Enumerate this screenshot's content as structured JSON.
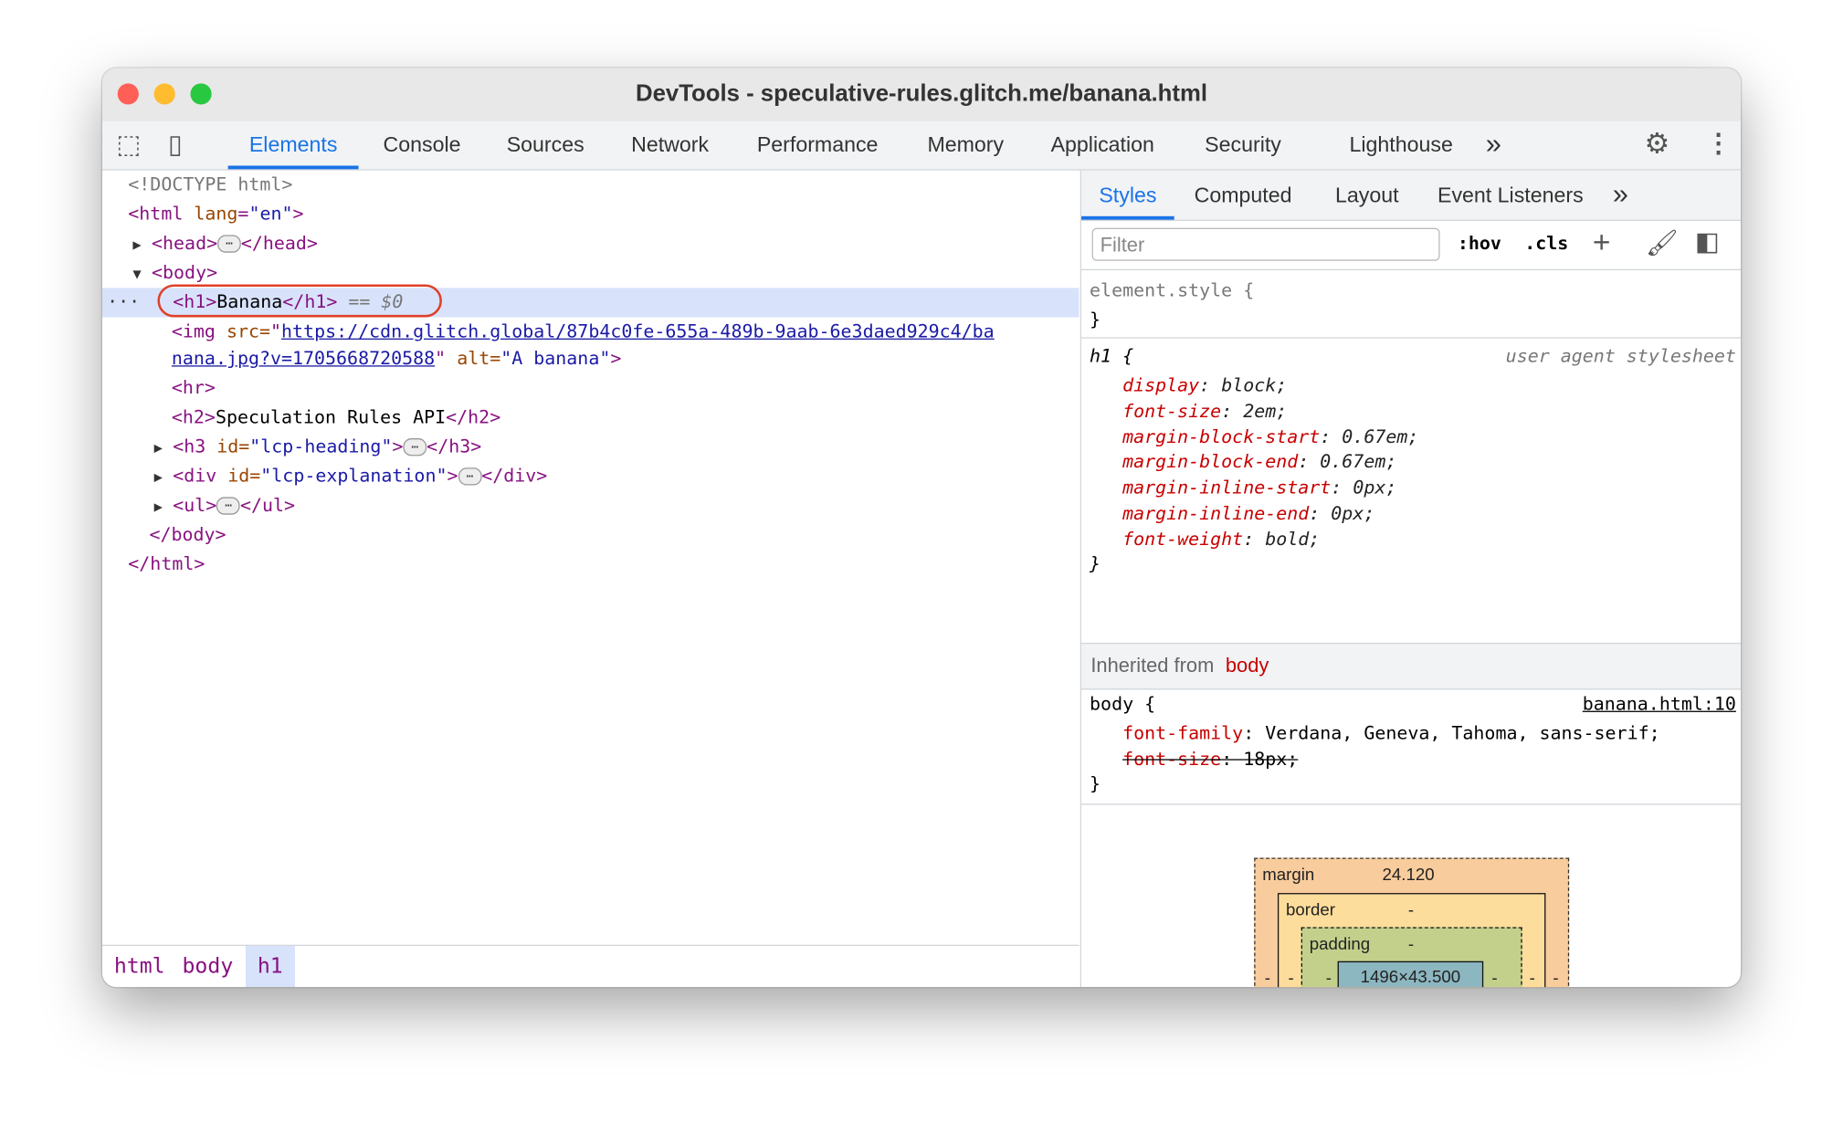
{
  "window": {
    "title": "DevTools - speculative-rules.glitch.me/banana.html",
    "lights": [
      "#ff5f57",
      "#febc2e",
      "#28c840"
    ]
  },
  "toolbar": {
    "tabs": [
      "Elements",
      "Console",
      "Sources",
      "Network",
      "Performance",
      "Memory",
      "Application",
      "Security",
      "Lighthouse"
    ],
    "active": "Elements",
    "more": "»",
    "icons": [
      "inspect-icon",
      "device-toolbar-icon",
      "settings-icon",
      "more-vert-icon"
    ]
  },
  "dom": {
    "doctype": "<!DOCTYPE html>",
    "html_open": "<html",
    "lang_attr": "lang",
    "lang_val": "\"en\"",
    "head_open": "<head>",
    "head_close": "</head>",
    "body_open": "<body>",
    "h1_open": "<h1>",
    "h1_text": "Banana",
    "h1_close": "</h1>",
    "h1_ref": "== $0",
    "img_open": "<img ",
    "src_attr": "src=",
    "src_q": "\"",
    "src_1": "https://cdn.glitch.global/87b4c0fe-655a-489b-9aab-6e3daed929c4/ba",
    "src_2": "nana.jpg?v=1705668720588",
    "alt_attr": "alt=",
    "alt_val": "\"A banana\"",
    "img_close": ">",
    "hr": "<hr>",
    "h2_open": "<h2>",
    "h2_text": "Speculation Rules API",
    "h2_close": "</h2>",
    "h3_open": "<h3 ",
    "h3_attr": "id=",
    "h3_val": "\"lcp-heading\"",
    "h3_close": "</h3>",
    "div_open": "<div ",
    "div_attr": "id=",
    "div_val": "\"lcp-explanation\"",
    "div_close": "</div>",
    "ul_open": "<ul>",
    "ul_close": "</ul>",
    "body_close": "</body>",
    "html_close": "</html>",
    "gt": ">",
    "ellipsis": "…",
    "dots": "···"
  },
  "breadcrumbs": [
    "html",
    "body",
    "h1"
  ],
  "styles": {
    "tabs": [
      "Styles",
      "Computed",
      "Layout",
      "Event Listeners"
    ],
    "more": "»",
    "filter_placeholder": "Filter",
    "hov": ":hov",
    "cls": ".cls",
    "element_style": "element.style {",
    "close": "}",
    "h1_selector": "h1 {",
    "h1_source": "user agent stylesheet",
    "h1_props": [
      [
        "display",
        "block"
      ],
      [
        "font-size",
        "2em"
      ],
      [
        "margin-block-start",
        "0.67em"
      ],
      [
        "margin-block-end",
        "0.67em"
      ],
      [
        "margin-inline-start",
        "0px"
      ],
      [
        "margin-inline-end",
        "0px"
      ],
      [
        "font-weight",
        "bold"
      ]
    ],
    "inherited_label": "Inherited from",
    "inherited_from": "body",
    "body_selector": "body {",
    "body_source": "banana.html:10",
    "body_props": [
      [
        "font-family",
        "Verdana, Geneva, Tahoma, sans-serif"
      ],
      [
        "font-size",
        "18px"
      ]
    ]
  },
  "box_model": {
    "margin_label": "margin",
    "margin_top": "24.120",
    "border_label": "border",
    "padding_label": "padding",
    "content": "1496×43.500",
    "dash": "-"
  }
}
